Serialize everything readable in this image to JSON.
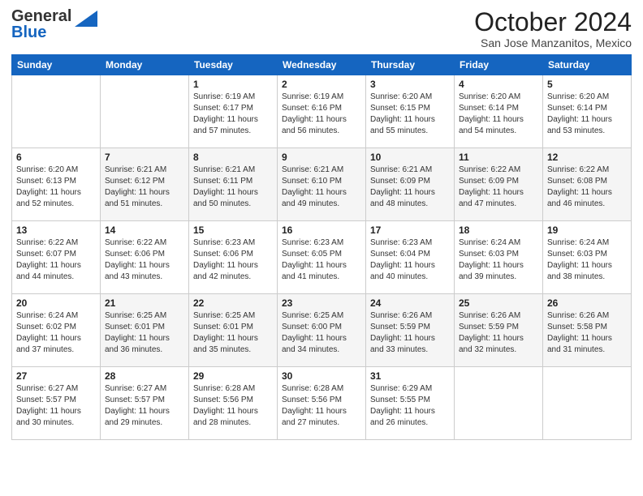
{
  "header": {
    "logo_general": "General",
    "logo_blue": "Blue",
    "month": "October 2024",
    "location": "San Jose Manzanitos, Mexico"
  },
  "days_of_week": [
    "Sunday",
    "Monday",
    "Tuesday",
    "Wednesday",
    "Thursday",
    "Friday",
    "Saturday"
  ],
  "weeks": [
    [
      {
        "num": "",
        "sunrise": "",
        "sunset": "",
        "daylight": ""
      },
      {
        "num": "",
        "sunrise": "",
        "sunset": "",
        "daylight": ""
      },
      {
        "num": "1",
        "sunrise": "Sunrise: 6:19 AM",
        "sunset": "Sunset: 6:17 PM",
        "daylight": "Daylight: 11 hours and 57 minutes."
      },
      {
        "num": "2",
        "sunrise": "Sunrise: 6:19 AM",
        "sunset": "Sunset: 6:16 PM",
        "daylight": "Daylight: 11 hours and 56 minutes."
      },
      {
        "num": "3",
        "sunrise": "Sunrise: 6:20 AM",
        "sunset": "Sunset: 6:15 PM",
        "daylight": "Daylight: 11 hours and 55 minutes."
      },
      {
        "num": "4",
        "sunrise": "Sunrise: 6:20 AM",
        "sunset": "Sunset: 6:14 PM",
        "daylight": "Daylight: 11 hours and 54 minutes."
      },
      {
        "num": "5",
        "sunrise": "Sunrise: 6:20 AM",
        "sunset": "Sunset: 6:14 PM",
        "daylight": "Daylight: 11 hours and 53 minutes."
      }
    ],
    [
      {
        "num": "6",
        "sunrise": "Sunrise: 6:20 AM",
        "sunset": "Sunset: 6:13 PM",
        "daylight": "Daylight: 11 hours and 52 minutes."
      },
      {
        "num": "7",
        "sunrise": "Sunrise: 6:21 AM",
        "sunset": "Sunset: 6:12 PM",
        "daylight": "Daylight: 11 hours and 51 minutes."
      },
      {
        "num": "8",
        "sunrise": "Sunrise: 6:21 AM",
        "sunset": "Sunset: 6:11 PM",
        "daylight": "Daylight: 11 hours and 50 minutes."
      },
      {
        "num": "9",
        "sunrise": "Sunrise: 6:21 AM",
        "sunset": "Sunset: 6:10 PM",
        "daylight": "Daylight: 11 hours and 49 minutes."
      },
      {
        "num": "10",
        "sunrise": "Sunrise: 6:21 AM",
        "sunset": "Sunset: 6:09 PM",
        "daylight": "Daylight: 11 hours and 48 minutes."
      },
      {
        "num": "11",
        "sunrise": "Sunrise: 6:22 AM",
        "sunset": "Sunset: 6:09 PM",
        "daylight": "Daylight: 11 hours and 47 minutes."
      },
      {
        "num": "12",
        "sunrise": "Sunrise: 6:22 AM",
        "sunset": "Sunset: 6:08 PM",
        "daylight": "Daylight: 11 hours and 46 minutes."
      }
    ],
    [
      {
        "num": "13",
        "sunrise": "Sunrise: 6:22 AM",
        "sunset": "Sunset: 6:07 PM",
        "daylight": "Daylight: 11 hours and 44 minutes."
      },
      {
        "num": "14",
        "sunrise": "Sunrise: 6:22 AM",
        "sunset": "Sunset: 6:06 PM",
        "daylight": "Daylight: 11 hours and 43 minutes."
      },
      {
        "num": "15",
        "sunrise": "Sunrise: 6:23 AM",
        "sunset": "Sunset: 6:06 PM",
        "daylight": "Daylight: 11 hours and 42 minutes."
      },
      {
        "num": "16",
        "sunrise": "Sunrise: 6:23 AM",
        "sunset": "Sunset: 6:05 PM",
        "daylight": "Daylight: 11 hours and 41 minutes."
      },
      {
        "num": "17",
        "sunrise": "Sunrise: 6:23 AM",
        "sunset": "Sunset: 6:04 PM",
        "daylight": "Daylight: 11 hours and 40 minutes."
      },
      {
        "num": "18",
        "sunrise": "Sunrise: 6:24 AM",
        "sunset": "Sunset: 6:03 PM",
        "daylight": "Daylight: 11 hours and 39 minutes."
      },
      {
        "num": "19",
        "sunrise": "Sunrise: 6:24 AM",
        "sunset": "Sunset: 6:03 PM",
        "daylight": "Daylight: 11 hours and 38 minutes."
      }
    ],
    [
      {
        "num": "20",
        "sunrise": "Sunrise: 6:24 AM",
        "sunset": "Sunset: 6:02 PM",
        "daylight": "Daylight: 11 hours and 37 minutes."
      },
      {
        "num": "21",
        "sunrise": "Sunrise: 6:25 AM",
        "sunset": "Sunset: 6:01 PM",
        "daylight": "Daylight: 11 hours and 36 minutes."
      },
      {
        "num": "22",
        "sunrise": "Sunrise: 6:25 AM",
        "sunset": "Sunset: 6:01 PM",
        "daylight": "Daylight: 11 hours and 35 minutes."
      },
      {
        "num": "23",
        "sunrise": "Sunrise: 6:25 AM",
        "sunset": "Sunset: 6:00 PM",
        "daylight": "Daylight: 11 hours and 34 minutes."
      },
      {
        "num": "24",
        "sunrise": "Sunrise: 6:26 AM",
        "sunset": "Sunset: 5:59 PM",
        "daylight": "Daylight: 11 hours and 33 minutes."
      },
      {
        "num": "25",
        "sunrise": "Sunrise: 6:26 AM",
        "sunset": "Sunset: 5:59 PM",
        "daylight": "Daylight: 11 hours and 32 minutes."
      },
      {
        "num": "26",
        "sunrise": "Sunrise: 6:26 AM",
        "sunset": "Sunset: 5:58 PM",
        "daylight": "Daylight: 11 hours and 31 minutes."
      }
    ],
    [
      {
        "num": "27",
        "sunrise": "Sunrise: 6:27 AM",
        "sunset": "Sunset: 5:57 PM",
        "daylight": "Daylight: 11 hours and 30 minutes."
      },
      {
        "num": "28",
        "sunrise": "Sunrise: 6:27 AM",
        "sunset": "Sunset: 5:57 PM",
        "daylight": "Daylight: 11 hours and 29 minutes."
      },
      {
        "num": "29",
        "sunrise": "Sunrise: 6:28 AM",
        "sunset": "Sunset: 5:56 PM",
        "daylight": "Daylight: 11 hours and 28 minutes."
      },
      {
        "num": "30",
        "sunrise": "Sunrise: 6:28 AM",
        "sunset": "Sunset: 5:56 PM",
        "daylight": "Daylight: 11 hours and 27 minutes."
      },
      {
        "num": "31",
        "sunrise": "Sunrise: 6:29 AM",
        "sunset": "Sunset: 5:55 PM",
        "daylight": "Daylight: 11 hours and 26 minutes."
      },
      {
        "num": "",
        "sunrise": "",
        "sunset": "",
        "daylight": ""
      },
      {
        "num": "",
        "sunrise": "",
        "sunset": "",
        "daylight": ""
      }
    ]
  ]
}
